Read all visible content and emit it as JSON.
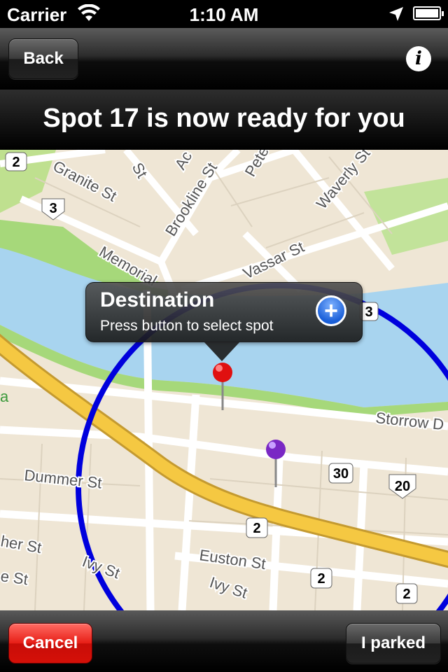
{
  "status_bar": {
    "carrier": "Carrier",
    "time": "1:10 AM"
  },
  "nav": {
    "back_label": "Back",
    "info_icon": "i"
  },
  "banner": {
    "message": "Spot 17 is now ready for you"
  },
  "map": {
    "streets": [
      "Granite St",
      "Brookline St",
      "Memorial",
      "Vassar St",
      "Waverly St",
      "Storrow D",
      "Dummer St",
      "Euston St",
      "Ivy St",
      "Ivy St",
      "her St",
      "e St",
      "St",
      "Ac",
      "Pete"
    ],
    "route_shields": [
      "2",
      "3",
      "30",
      "20",
      "2",
      "2",
      "2",
      "3"
    ],
    "park_label": "a",
    "callout": {
      "title": "Destination",
      "subtitle": "Press button to select spot",
      "plus_icon": "+"
    },
    "pins": [
      "red",
      "purple"
    ],
    "colors": {
      "water": "#a8d4ef",
      "park": "#a6d87a",
      "highway": "#f5c842",
      "circle": "#0000dd",
      "land": "#efe6d5"
    }
  },
  "toolbar": {
    "cancel_label": "Cancel",
    "parked_label": "I parked"
  }
}
